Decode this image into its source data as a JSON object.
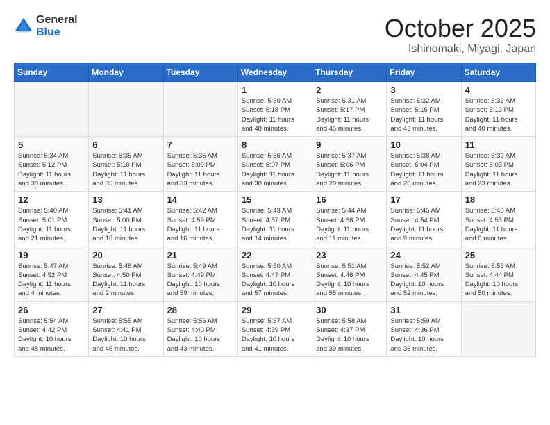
{
  "header": {
    "logo_general": "General",
    "logo_blue": "Blue",
    "month_title": "October 2025",
    "location": "Ishinomaki, Miyagi, Japan"
  },
  "weekdays": [
    "Sunday",
    "Monday",
    "Tuesday",
    "Wednesday",
    "Thursday",
    "Friday",
    "Saturday"
  ],
  "weeks": [
    [
      {
        "day": "",
        "info": ""
      },
      {
        "day": "",
        "info": ""
      },
      {
        "day": "",
        "info": ""
      },
      {
        "day": "1",
        "info": "Sunrise: 5:30 AM\nSunset: 5:18 PM\nDaylight: 11 hours\nand 48 minutes."
      },
      {
        "day": "2",
        "info": "Sunrise: 5:31 AM\nSunset: 5:17 PM\nDaylight: 11 hours\nand 45 minutes."
      },
      {
        "day": "3",
        "info": "Sunrise: 5:32 AM\nSunset: 5:15 PM\nDaylight: 11 hours\nand 43 minutes."
      },
      {
        "day": "4",
        "info": "Sunrise: 5:33 AM\nSunset: 5:13 PM\nDaylight: 11 hours\nand 40 minutes."
      }
    ],
    [
      {
        "day": "5",
        "info": "Sunrise: 5:34 AM\nSunset: 5:12 PM\nDaylight: 11 hours\nand 38 minutes."
      },
      {
        "day": "6",
        "info": "Sunrise: 5:35 AM\nSunset: 5:10 PM\nDaylight: 11 hours\nand 35 minutes."
      },
      {
        "day": "7",
        "info": "Sunrise: 5:35 AM\nSunset: 5:09 PM\nDaylight: 11 hours\nand 33 minutes."
      },
      {
        "day": "8",
        "info": "Sunrise: 5:36 AM\nSunset: 5:07 PM\nDaylight: 11 hours\nand 30 minutes."
      },
      {
        "day": "9",
        "info": "Sunrise: 5:37 AM\nSunset: 5:06 PM\nDaylight: 11 hours\nand 28 minutes."
      },
      {
        "day": "10",
        "info": "Sunrise: 5:38 AM\nSunset: 5:04 PM\nDaylight: 11 hours\nand 26 minutes."
      },
      {
        "day": "11",
        "info": "Sunrise: 5:39 AM\nSunset: 5:03 PM\nDaylight: 11 hours\nand 23 minutes."
      }
    ],
    [
      {
        "day": "12",
        "info": "Sunrise: 5:40 AM\nSunset: 5:01 PM\nDaylight: 11 hours\nand 21 minutes."
      },
      {
        "day": "13",
        "info": "Sunrise: 5:41 AM\nSunset: 5:00 PM\nDaylight: 11 hours\nand 18 minutes."
      },
      {
        "day": "14",
        "info": "Sunrise: 5:42 AM\nSunset: 4:59 PM\nDaylight: 11 hours\nand 16 minutes."
      },
      {
        "day": "15",
        "info": "Sunrise: 5:43 AM\nSunset: 4:57 PM\nDaylight: 11 hours\nand 14 minutes."
      },
      {
        "day": "16",
        "info": "Sunrise: 5:44 AM\nSunset: 4:56 PM\nDaylight: 11 hours\nand 11 minutes."
      },
      {
        "day": "17",
        "info": "Sunrise: 5:45 AM\nSunset: 4:54 PM\nDaylight: 11 hours\nand 9 minutes."
      },
      {
        "day": "18",
        "info": "Sunrise: 5:46 AM\nSunset: 4:53 PM\nDaylight: 11 hours\nand 6 minutes."
      }
    ],
    [
      {
        "day": "19",
        "info": "Sunrise: 5:47 AM\nSunset: 4:52 PM\nDaylight: 11 hours\nand 4 minutes."
      },
      {
        "day": "20",
        "info": "Sunrise: 5:48 AM\nSunset: 4:50 PM\nDaylight: 11 hours\nand 2 minutes."
      },
      {
        "day": "21",
        "info": "Sunrise: 5:49 AM\nSunset: 4:49 PM\nDaylight: 10 hours\nand 59 minutes."
      },
      {
        "day": "22",
        "info": "Sunrise: 5:50 AM\nSunset: 4:47 PM\nDaylight: 10 hours\nand 57 minutes."
      },
      {
        "day": "23",
        "info": "Sunrise: 5:51 AM\nSunset: 4:46 PM\nDaylight: 10 hours\nand 55 minutes."
      },
      {
        "day": "24",
        "info": "Sunrise: 5:52 AM\nSunset: 4:45 PM\nDaylight: 10 hours\nand 52 minutes."
      },
      {
        "day": "25",
        "info": "Sunrise: 5:53 AM\nSunset: 4:44 PM\nDaylight: 10 hours\nand 50 minutes."
      }
    ],
    [
      {
        "day": "26",
        "info": "Sunrise: 5:54 AM\nSunset: 4:42 PM\nDaylight: 10 hours\nand 48 minutes."
      },
      {
        "day": "27",
        "info": "Sunrise: 5:55 AM\nSunset: 4:41 PM\nDaylight: 10 hours\nand 45 minutes."
      },
      {
        "day": "28",
        "info": "Sunrise: 5:56 AM\nSunset: 4:40 PM\nDaylight: 10 hours\nand 43 minutes."
      },
      {
        "day": "29",
        "info": "Sunrise: 5:57 AM\nSunset: 4:39 PM\nDaylight: 10 hours\nand 41 minutes."
      },
      {
        "day": "30",
        "info": "Sunrise: 5:58 AM\nSunset: 4:37 PM\nDaylight: 10 hours\nand 39 minutes."
      },
      {
        "day": "31",
        "info": "Sunrise: 5:59 AM\nSunset: 4:36 PM\nDaylight: 10 hours\nand 36 minutes."
      },
      {
        "day": "",
        "info": ""
      }
    ]
  ]
}
